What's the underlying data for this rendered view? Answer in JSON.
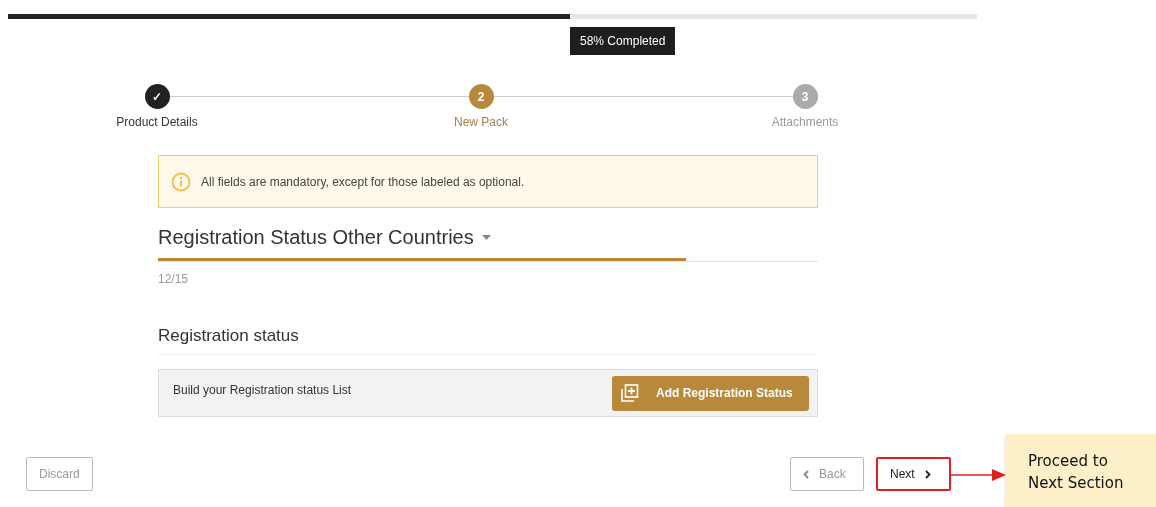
{
  "progress": {
    "level": 0.58,
    "label": "58% Completed"
  },
  "steps": [
    {
      "kind": "done",
      "icon": "✓",
      "label": "Product Details"
    },
    {
      "kind": "current",
      "icon": "2",
      "label": "New Pack"
    },
    {
      "kind": "upcoming",
      "icon": "3",
      "label": "Attachments"
    }
  ],
  "notice": {
    "text": "All fields are mandatory, except for those labeled as optional."
  },
  "section": {
    "title": "Registration Status Other Countries",
    "count": "12/15",
    "level": 0.8
  },
  "subsection": {
    "title": "Registration status",
    "hint": "Build your Registration status List",
    "button": "Add Registration Status"
  },
  "footer": {
    "discard": "Discard",
    "back": "Back",
    "next": "Next",
    "next_highlighted": true
  },
  "annotation": {
    "text": "Proceed to Next Section"
  }
}
